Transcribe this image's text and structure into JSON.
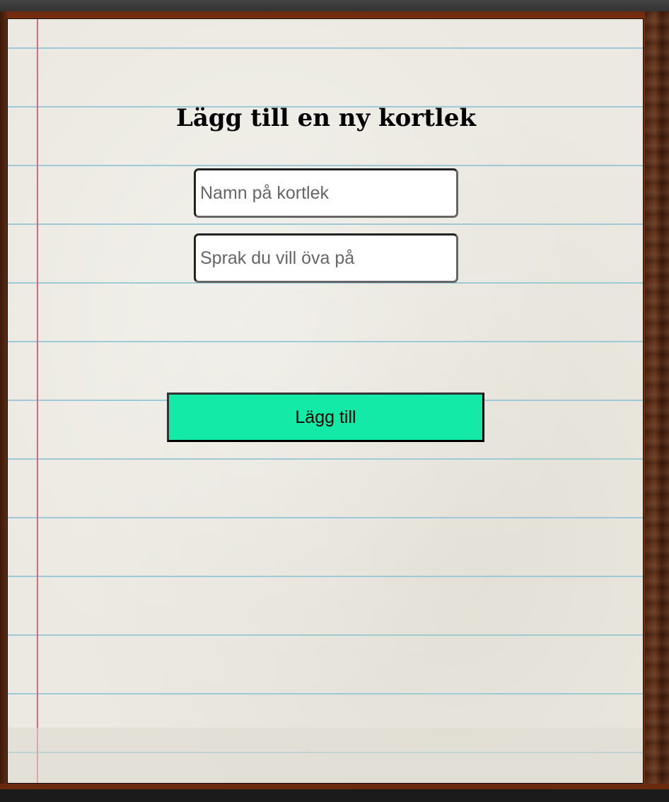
{
  "form": {
    "title": "Lägg till en ny kortlek",
    "deck_name_placeholder": "Namn på kortlek",
    "language_placeholder": "Sprak du vill öva på",
    "submit_label": "Lägg till"
  },
  "theme": {
    "paper_color": "#ebe9e1",
    "ruled_line_color": "#9ec9d6",
    "margin_line_color": "#d9667a",
    "button_color": "#13eaa8",
    "wood_color": "#6b3a1f"
  }
}
